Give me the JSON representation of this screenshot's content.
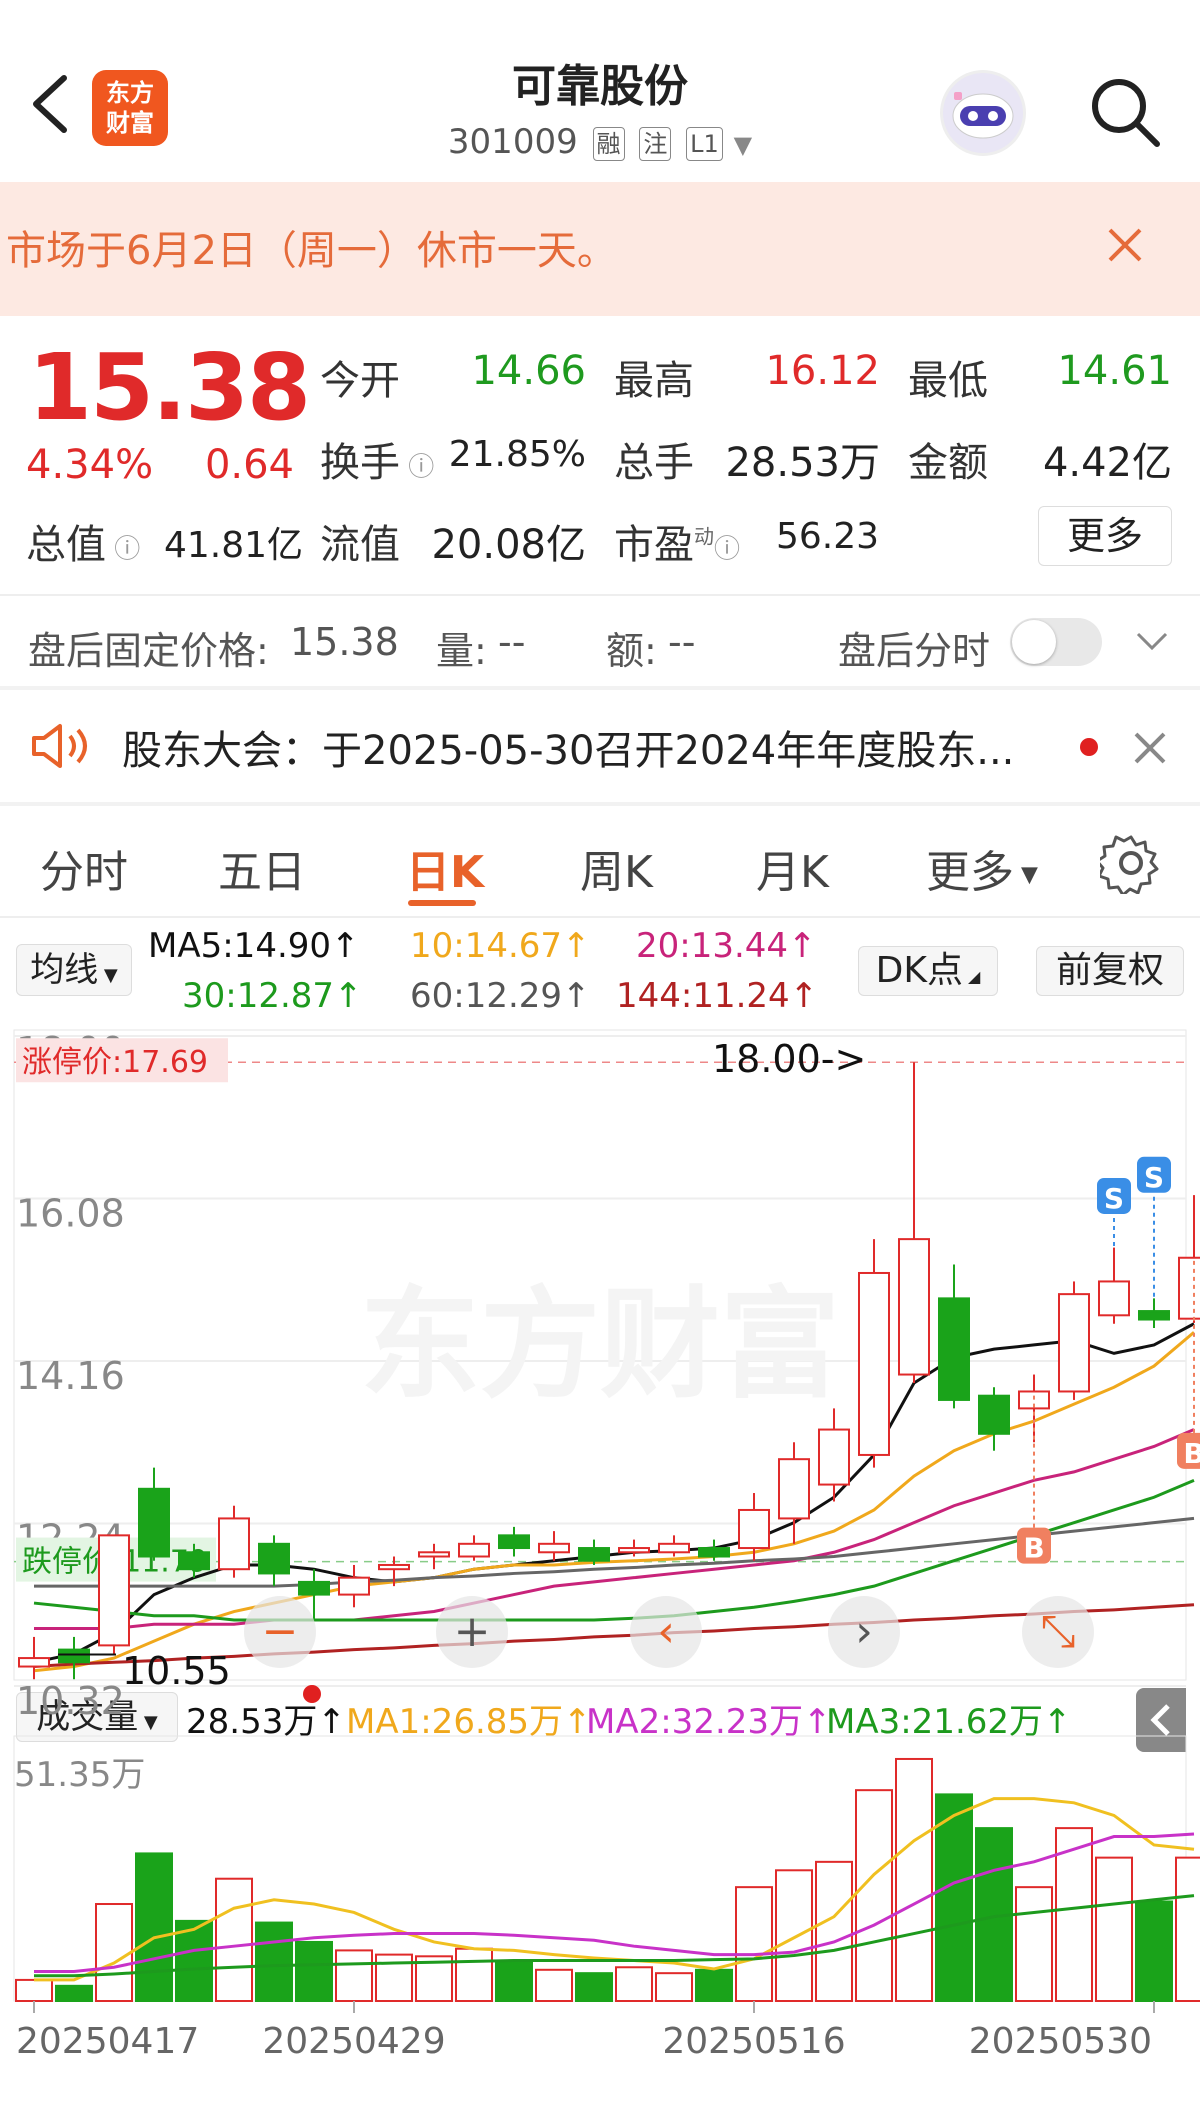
{
  "header": {
    "title": "可靠股份",
    "code": "301009",
    "tags": [
      "融",
      "注",
      "L1"
    ],
    "logo_text": "东方\n财富"
  },
  "notice": {
    "text": "市场于6月2日（周一）休市一天。"
  },
  "quote": {
    "price": "15.38",
    "change_pct": "4.34%",
    "change": "0.64",
    "open_label": "今开",
    "open": "14.66",
    "high_label": "最高",
    "high": "16.12",
    "low_label": "最低",
    "low": "14.61",
    "turnover_label": "换手",
    "turnover": "21.85%",
    "volume_label": "总手",
    "volume": "28.53万",
    "amount_label": "金额",
    "amount": "4.42亿",
    "mktcap_label": "总值",
    "mktcap": "41.81亿",
    "float_label": "流值",
    "float": "20.08亿",
    "pe_label": "市盈",
    "pe_sup": "动",
    "pe": "56.23",
    "more_label": "更多"
  },
  "after_hours": {
    "fixed_label": "盘后固定价格:",
    "fixed_price": "15.38",
    "qty_label": "量:",
    "qty": "--",
    "amt_label": "额:",
    "amt": "--",
    "toggle_label": "盘后分时"
  },
  "meeting": {
    "text": "股东大会：于2025-05-30召开2024年年度股东..."
  },
  "tabs": [
    {
      "label": "分时"
    },
    {
      "label": "五日"
    },
    {
      "label": "日K"
    },
    {
      "label": "周K"
    },
    {
      "label": "月K"
    },
    {
      "label": "更多"
    }
  ],
  "ma": {
    "selector": "均线",
    "ma5": "MA5:14.90↑",
    "ma10": "10:14.67↑",
    "ma20": "20:13.44↑",
    "ma30": "30:12.87↑",
    "ma60": "60:12.29↑",
    "ma144": "144:11.24↑",
    "dk_label": "DK点",
    "adjust_label": "前复权"
  },
  "colors": {
    "up": "#e02a2a",
    "down": "#1aa31a",
    "ma5": "#111111",
    "ma10": "#f0a81c",
    "ma20": "#c8237a",
    "ma30": "#1d9a1d",
    "ma60": "#666666",
    "ma144": "#b02222"
  },
  "chart_data": {
    "type": "candlestick",
    "price_axis": {
      "ticks": [
        "18.00",
        "16.08",
        "14.16",
        "12.24",
        "10.32"
      ],
      "ylim": [
        10.32,
        18.0
      ]
    },
    "annotations": {
      "limit_up": "涨停价:17.69",
      "limit_down": "跌停价:11.79",
      "high_marker": "18.00->",
      "low_marker": "10.55",
      "signals": [
        "S",
        "S",
        "B",
        "B"
      ]
    },
    "candles": [
      {
        "o": 10.55,
        "c": 10.65,
        "h": 10.9,
        "l": 10.4
      },
      {
        "o": 10.75,
        "c": 10.6,
        "h": 10.9,
        "l": 10.4
      },
      {
        "o": 10.8,
        "c": 12.1,
        "h": 12.1,
        "l": 10.7
      },
      {
        "o": 12.65,
        "c": 11.85,
        "h": 12.9,
        "l": 11.8
      },
      {
        "o": 11.9,
        "c": 11.7,
        "h": 12.0,
        "l": 11.6
      },
      {
        "o": 11.7,
        "c": 12.3,
        "h": 12.45,
        "l": 11.6
      },
      {
        "o": 12.0,
        "c": 11.65,
        "h": 12.1,
        "l": 11.5
      },
      {
        "o": 11.55,
        "c": 11.4,
        "h": 11.7,
        "l": 11.1
      },
      {
        "o": 11.4,
        "c": 11.6,
        "h": 11.75,
        "l": 11.25
      },
      {
        "o": 11.7,
        "c": 11.75,
        "h": 11.85,
        "l": 11.5
      },
      {
        "o": 11.85,
        "c": 11.9,
        "h": 12.0,
        "l": 11.7
      },
      {
        "o": 11.85,
        "c": 12.0,
        "h": 12.1,
        "l": 11.8
      },
      {
        "o": 12.1,
        "c": 11.95,
        "h": 12.2,
        "l": 11.85
      },
      {
        "o": 11.9,
        "c": 12.0,
        "h": 12.15,
        "l": 11.8
      },
      {
        "o": 11.95,
        "c": 11.8,
        "h": 12.05,
        "l": 11.75
      },
      {
        "o": 11.9,
        "c": 11.95,
        "h": 12.05,
        "l": 11.85
      },
      {
        "o": 11.9,
        "c": 12.0,
        "h": 12.1,
        "l": 11.85
      },
      {
        "o": 11.95,
        "c": 11.85,
        "h": 12.05,
        "l": 11.8
      },
      {
        "o": 11.95,
        "c": 12.4,
        "h": 12.6,
        "l": 11.8
      },
      {
        "o": 12.3,
        "c": 13.0,
        "h": 13.2,
        "l": 12.0
      },
      {
        "o": 12.7,
        "c": 13.35,
        "h": 13.6,
        "l": 12.5
      },
      {
        "o": 13.05,
        "c": 15.2,
        "h": 15.6,
        "l": 12.9
      },
      {
        "o": 14.0,
        "c": 15.6,
        "h": 17.69,
        "l": 13.9
      },
      {
        "o": 14.9,
        "c": 13.7,
        "h": 15.3,
        "l": 13.6
      },
      {
        "o": 13.75,
        "c": 13.3,
        "h": 13.85,
        "l": 13.1
      },
      {
        "o": 13.6,
        "c": 13.8,
        "h": 14.0,
        "l": 13.2
      },
      {
        "o": 13.8,
        "c": 14.95,
        "h": 15.1,
        "l": 13.7
      },
      {
        "o": 14.7,
        "c": 15.1,
        "h": 15.5,
        "l": 14.6
      },
      {
        "o": 14.75,
        "c": 14.65,
        "h": 14.9,
        "l": 14.55
      },
      {
        "o": 14.66,
        "c": 15.38,
        "h": 16.12,
        "l": 14.61
      }
    ],
    "ma_series": {
      "MA5": [
        10.6,
        10.7,
        10.95,
        11.4,
        11.6,
        11.75,
        11.75,
        11.7,
        11.6,
        11.55,
        11.6,
        11.7,
        11.75,
        11.8,
        11.85,
        11.9,
        11.92,
        11.95,
        12.05,
        12.25,
        12.55,
        13.05,
        13.9,
        14.2,
        14.3,
        14.35,
        14.4,
        14.25,
        14.35,
        14.6
      ],
      "MA10": [
        10.5,
        10.55,
        10.65,
        10.85,
        11.05,
        11.2,
        11.3,
        11.4,
        11.5,
        11.55,
        11.6,
        11.7,
        11.75,
        11.75,
        11.78,
        11.8,
        11.82,
        11.85,
        11.9,
        12.0,
        12.15,
        12.4,
        12.8,
        13.1,
        13.3,
        13.45,
        13.65,
        13.85,
        14.1,
        14.5
      ],
      "MA20": [
        11.0,
        11.0,
        11.0,
        11.05,
        11.05,
        11.05,
        11.1,
        11.1,
        11.1,
        11.15,
        11.2,
        11.3,
        11.4,
        11.5,
        11.55,
        11.6,
        11.65,
        11.7,
        11.75,
        11.8,
        11.9,
        12.05,
        12.25,
        12.45,
        12.6,
        12.75,
        12.85,
        13.0,
        13.15,
        13.35
      ],
      "MA30": [
        11.3,
        11.25,
        11.2,
        11.15,
        11.15,
        11.1,
        11.1,
        11.1,
        11.1,
        11.1,
        11.1,
        11.1,
        11.1,
        11.1,
        11.1,
        11.12,
        11.15,
        11.2,
        11.25,
        11.32,
        11.4,
        11.5,
        11.65,
        11.8,
        11.95,
        12.1,
        12.25,
        12.4,
        12.55,
        12.75
      ],
      "MA60": [
        11.5,
        11.5,
        11.5,
        11.5,
        11.5,
        11.5,
        11.5,
        11.52,
        11.55,
        11.57,
        11.6,
        11.62,
        11.65,
        11.67,
        11.7,
        11.72,
        11.75,
        11.77,
        11.8,
        11.82,
        11.85,
        11.9,
        11.95,
        12.0,
        12.05,
        12.1,
        12.15,
        12.2,
        12.25,
        12.3
      ],
      "MA144": [
        10.55,
        10.58,
        10.6,
        10.62,
        10.65,
        10.67,
        10.7,
        10.72,
        10.75,
        10.77,
        10.8,
        10.82,
        10.85,
        10.87,
        10.9,
        10.92,
        10.95,
        10.97,
        11.0,
        11.02,
        11.05,
        11.07,
        11.1,
        11.12,
        11.15,
        11.17,
        11.2,
        11.22,
        11.25,
        11.28
      ]
    },
    "volume": {
      "label": "成交量",
      "value": "28.53万↑",
      "ma1": "MA1:26.85万↑",
      "ma2": "MA2:32.23万↑",
      "ma3": "MA3:21.62万↑",
      "axis_max": "51.35万",
      "values": [
        2.5,
        1.8,
        11.5,
        17.5,
        9.5,
        14.5,
        9.3,
        7.0,
        6.0,
        5.5,
        5.3,
        6.2,
        4.6,
        3.7,
        3.3,
        4.0,
        3.3,
        3.7,
        13.5,
        15.5,
        16.5,
        25.0,
        28.7,
        24.5,
        20.5,
        13.5,
        20.5,
        17.0,
        11.8,
        17.0
      ],
      "ma1_values": [
        2.5,
        2.5,
        4.5,
        7.5,
        8.5,
        11.0,
        12.0,
        11.5,
        10.5,
        8.5,
        7.0,
        6.2,
        6.0,
        5.5,
        5.1,
        4.8,
        4.5,
        3.8,
        5.0,
        7.5,
        10.0,
        15.0,
        19.0,
        22.0,
        24.0,
        24.0,
        23.5,
        22.0,
        18.5,
        18.0
      ],
      "ma2_values": [
        3.5,
        3.5,
        4.0,
        5.0,
        6.0,
        6.5,
        7.0,
        7.5,
        7.8,
        8.0,
        8.0,
        8.0,
        7.8,
        7.5,
        7.2,
        6.5,
        6.0,
        5.5,
        5.5,
        5.8,
        7.0,
        9.0,
        11.5,
        14.0,
        15.5,
        16.5,
        18.0,
        19.5,
        19.5,
        19.8
      ],
      "ma3_values": [
        3.0,
        3.0,
        3.2,
        3.5,
        3.8,
        4.0,
        4.2,
        4.3,
        4.4,
        4.5,
        4.6,
        4.7,
        4.8,
        4.8,
        4.8,
        4.8,
        4.8,
        4.9,
        5.0,
        5.4,
        6.0,
        7.0,
        8.0,
        9.0,
        10.0,
        10.5,
        11.0,
        11.5,
        12.0,
        12.5
      ]
    },
    "dates": [
      "20250417",
      "20250429",
      "20250516",
      "20250530"
    ]
  }
}
